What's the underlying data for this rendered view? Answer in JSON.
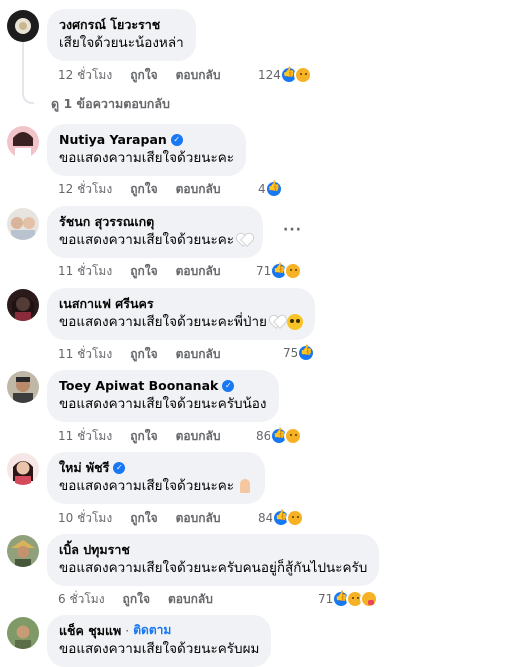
{
  "icons": {
    "like": "like-reaction-icon",
    "sad": "sad-reaction-icon",
    "care": "care-reaction-icon",
    "verified": "verified-badge-icon",
    "more": "more-options-icon"
  },
  "colors": {
    "bubble": "#f0f2f5",
    "link": "#1877f2",
    "muted": "#65676b",
    "like": "#1877f2",
    "sad": "#f7b125"
  },
  "labels": {
    "like": "ถูกใจ",
    "reply": "ตอบกลับ",
    "follow": "ติดตาม",
    "more": "···"
  },
  "reply_thread": {
    "author": "วงศกรณ์ โยวะราช",
    "text": "เสียใจด้วยนะน้องหล่า",
    "time": "12 ชั่วโมง",
    "reactions": "124",
    "view_replies": "ดู 1 ข้อความตอบกลับ"
  },
  "comments": [
    {
      "author": "Nutiya Yarapan",
      "text": "ขอแสดงความเสียใจด้วยนะคะ",
      "time": "12 ชั่วโมง",
      "reactions": "4"
    },
    {
      "author": "รัชนก สุวรรณเกตุ",
      "text": "ขอแสดงความเสียใจด้วยนะคะ",
      "time": "11 ชั่วโมง",
      "reactions": "71"
    },
    {
      "author": "เนสกาแฟ ศรีนคร",
      "text": "ขอแสดงความเสียใจด้วยนะคะพี่ป่าย",
      "time": "11 ชั่วโมง",
      "reactions": "75"
    },
    {
      "author": "Toey Apiwat Boonanak",
      "text": "ขอแสดงความเสียใจด้วยนะครับน้อง",
      "time": "11 ชั่วโมง",
      "reactions": "86"
    },
    {
      "author": "ใหม่ พัชรี",
      "text": "ขอแสดงความเสียใจด้วยนะคะ",
      "time": "10 ชั่วโมง",
      "reactions": "84"
    },
    {
      "author": "เบิ้ล ปทุมราช",
      "text": "ขอแสดงความเสียใจด้วยนะครับคนอยู่ก็สู้กันไปนะครับ",
      "time": "6 ชั่วโมง",
      "reactions": "71"
    },
    {
      "author": "แช็ค ชุมแพ",
      "text": "ขอแสดงความเสียใจด้วยนะครับผม",
      "time": "",
      "reactions": ""
    }
  ]
}
